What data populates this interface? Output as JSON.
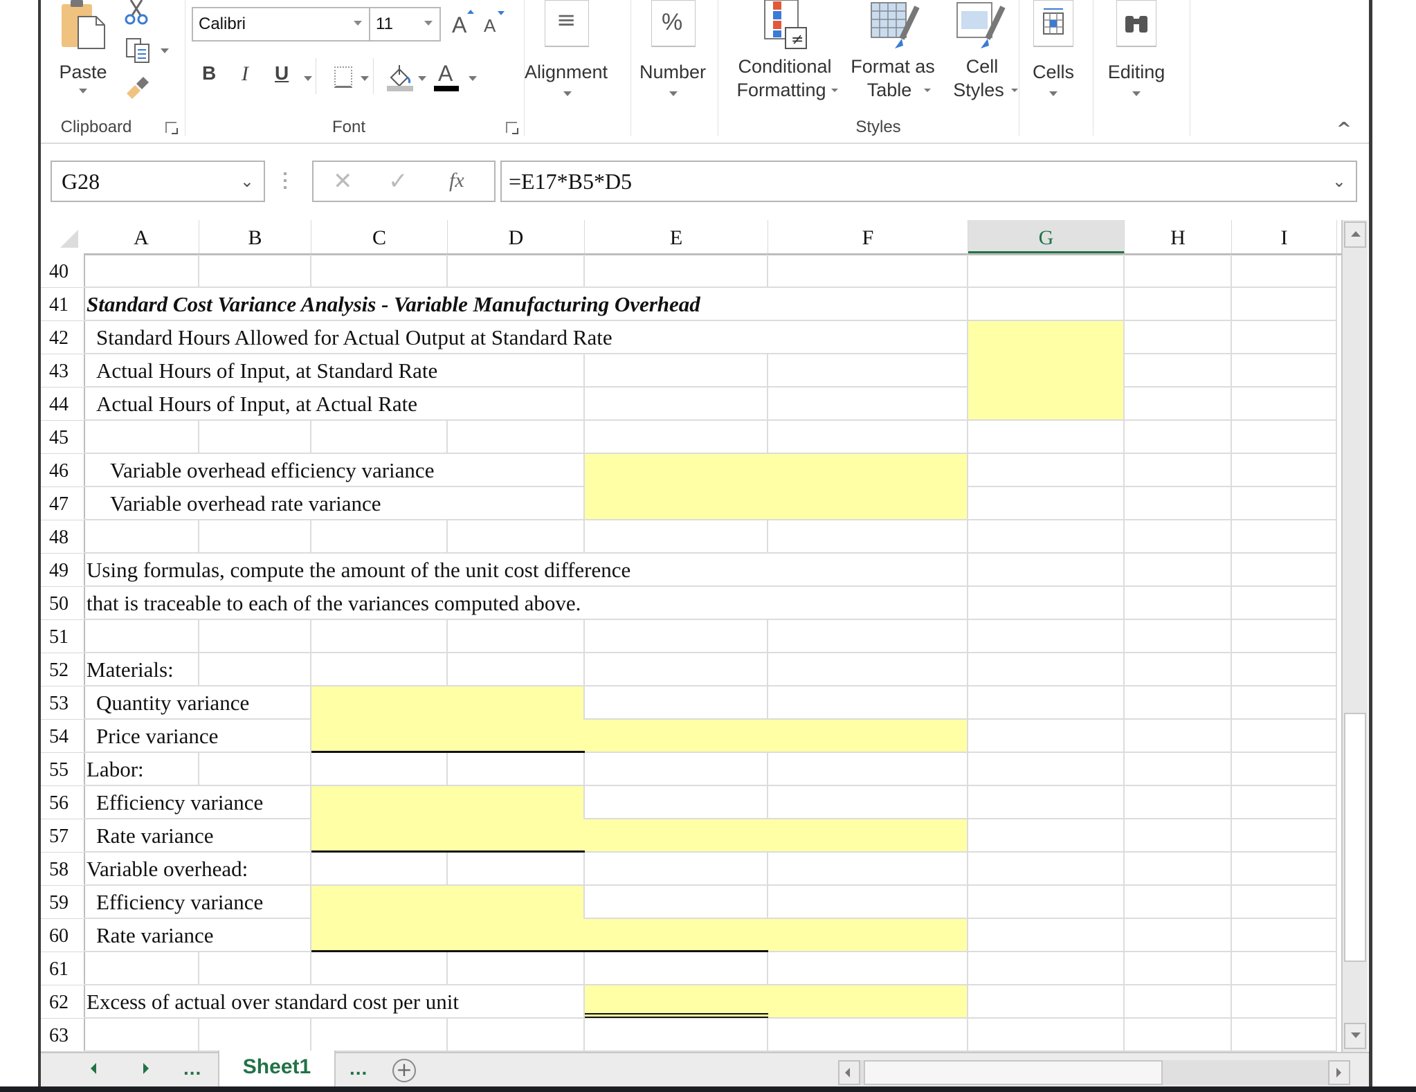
{
  "ribbon": {
    "clipboard": {
      "paste_label": "Paste",
      "group_label": "Clipboard"
    },
    "font": {
      "group_label": "Font",
      "font_name": "Calibri",
      "font_size": "11",
      "bold_label": "B",
      "italic_label": "I",
      "underline_label": "U",
      "increase_font_label": "A",
      "decrease_font_label": "A",
      "font_color_label": "A",
      "font_color": "#000000",
      "fill_color": "#c0c0c0"
    },
    "alignment": {
      "label": "Alignment",
      "icon_text": "≡"
    },
    "number": {
      "label": "Number",
      "icon_text": "%"
    },
    "styles": {
      "group_label": "Styles",
      "conditional_formatting_line1": "Conditional",
      "conditional_formatting_line2": "Formatting",
      "format_as_table_line1": "Format as",
      "format_as_table_line2": "Table",
      "cell_styles_line1": "Cell",
      "cell_styles_line2": "Styles"
    },
    "cells": {
      "label": "Cells"
    },
    "editing": {
      "label": "Editing"
    },
    "collapse_icon": "^"
  },
  "formula_bar": {
    "name_box": "G28",
    "cancel_icon": "✕",
    "enter_icon": "✓",
    "fx_label": "fx",
    "formula": "=E17*B5*D5"
  },
  "columns": [
    "A",
    "B",
    "C",
    "D",
    "E",
    "F",
    "G",
    "H",
    "I"
  ],
  "selected_column": "G",
  "rows": [
    {
      "num": "40",
      "text": ""
    },
    {
      "num": "41",
      "text": "Standard Cost Variance Analysis - Variable Manufacturing Overhead"
    },
    {
      "num": "42",
      "text": "Standard Hours Allowed for Actual Output at Standard Rate"
    },
    {
      "num": "43",
      "text": "Actual Hours of Input, at Standard Rate"
    },
    {
      "num": "44",
      "text": "Actual Hours of Input, at Actual Rate"
    },
    {
      "num": "45",
      "text": ""
    },
    {
      "num": "46",
      "text": "Variable overhead efficiency variance"
    },
    {
      "num": "47",
      "text": "Variable overhead rate variance"
    },
    {
      "num": "48",
      "text": ""
    },
    {
      "num": "49",
      "text": "Using formulas, compute the amount of the unit cost difference"
    },
    {
      "num": "50",
      "text": "that is traceable to each of the variances computed above."
    },
    {
      "num": "51",
      "text": ""
    },
    {
      "num": "52",
      "text": "Materials:"
    },
    {
      "num": "53",
      "text": "Quantity variance"
    },
    {
      "num": "54",
      "text": "Price variance"
    },
    {
      "num": "55",
      "text": "Labor:"
    },
    {
      "num": "56",
      "text": "Efficiency variance"
    },
    {
      "num": "57",
      "text": "Rate variance"
    },
    {
      "num": "58",
      "text": "Variable overhead:"
    },
    {
      "num": "59",
      "text": "Efficiency variance"
    },
    {
      "num": "60",
      "text": "Rate variance"
    },
    {
      "num": "61",
      "text": ""
    },
    {
      "num": "62",
      "text": "Excess of actual over standard cost per unit"
    },
    {
      "num": "63",
      "text": ""
    }
  ],
  "input_fill_color": "#ffffa6",
  "accent_color": "#217346",
  "sheet_tabs": {
    "active": "Sheet1",
    "ellipsis_left": "...",
    "ellipsis_right": "...",
    "add_icon": "+"
  }
}
